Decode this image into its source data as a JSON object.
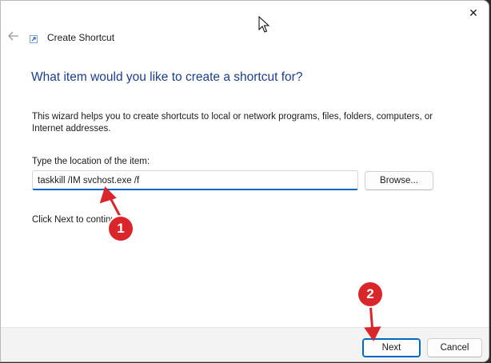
{
  "window": {
    "title": "Create Shortcut",
    "close_glyph": "✕",
    "back_icon": "back-arrow-icon",
    "app_icon": "shortcut-icon"
  },
  "main": {
    "heading": "What item would you like to create a shortcut for?",
    "description": "This wizard helps you to create shortcuts to local or network programs, files, folders, computers, or Internet addresses.",
    "location_label": "Type the location of the item:",
    "location_value": "taskkill /IM svchost.exe /f",
    "browse_label": "Browse...",
    "hint": "Click Next to continue."
  },
  "footer": {
    "next_label": "Next",
    "cancel_label": "Cancel"
  },
  "annotations": {
    "badge_1": "1",
    "badge_2": "2",
    "color": "#d9262a"
  },
  "colors": {
    "heading": "#1c3d8c",
    "accent": "#0067c0"
  }
}
